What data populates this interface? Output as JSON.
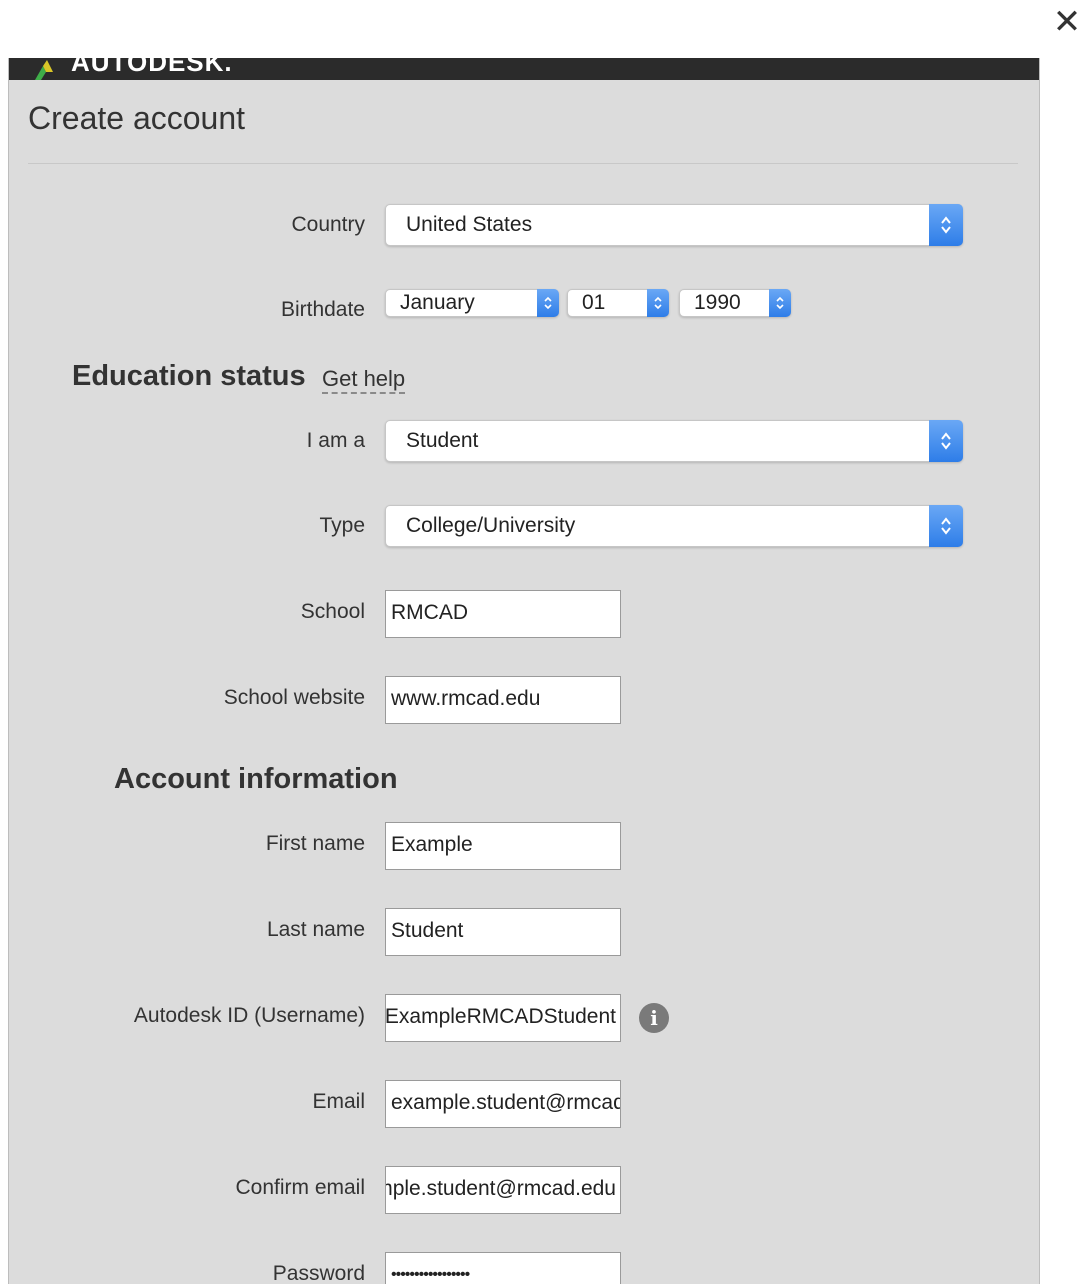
{
  "window": {
    "close_glyph": "✕"
  },
  "brand": {
    "logo_text": "AUTODESK."
  },
  "header": {
    "title": "Create account"
  },
  "form": {
    "country": {
      "label": "Country",
      "value": "United States"
    },
    "birthdate": {
      "label": "Birthdate",
      "month": "January",
      "day": "01",
      "year": "1990"
    },
    "education": {
      "heading": "Education status",
      "help_link": "Get help",
      "i_am_a": {
        "label": "I am a",
        "value": "Student"
      },
      "type": {
        "label": "Type",
        "value": "College/University"
      },
      "school": {
        "label": "School",
        "value": "RMCAD"
      },
      "school_website": {
        "label": "School website",
        "value": "www.rmcad.edu"
      }
    },
    "account": {
      "heading": "Account information",
      "first_name": {
        "label": "First name",
        "value": "Example"
      },
      "last_name": {
        "label": "Last name",
        "value": "Student"
      },
      "autodesk_id": {
        "label": "Autodesk ID (Username)",
        "value": "ExampleRMCADStudent",
        "info_icon": "info-icon"
      },
      "email": {
        "label": "Email",
        "value": "example.student@rmcad.edu"
      },
      "confirm_email": {
        "label": "Confirm email",
        "value": "example.student@rmcad.edu"
      },
      "password": {
        "label": "Password",
        "value": "•••••••••••••••••"
      }
    }
  },
  "colors": {
    "select_arrow": "#2e7de8",
    "topbar": "#2b2b2b",
    "panel": "#dcdcdc"
  }
}
